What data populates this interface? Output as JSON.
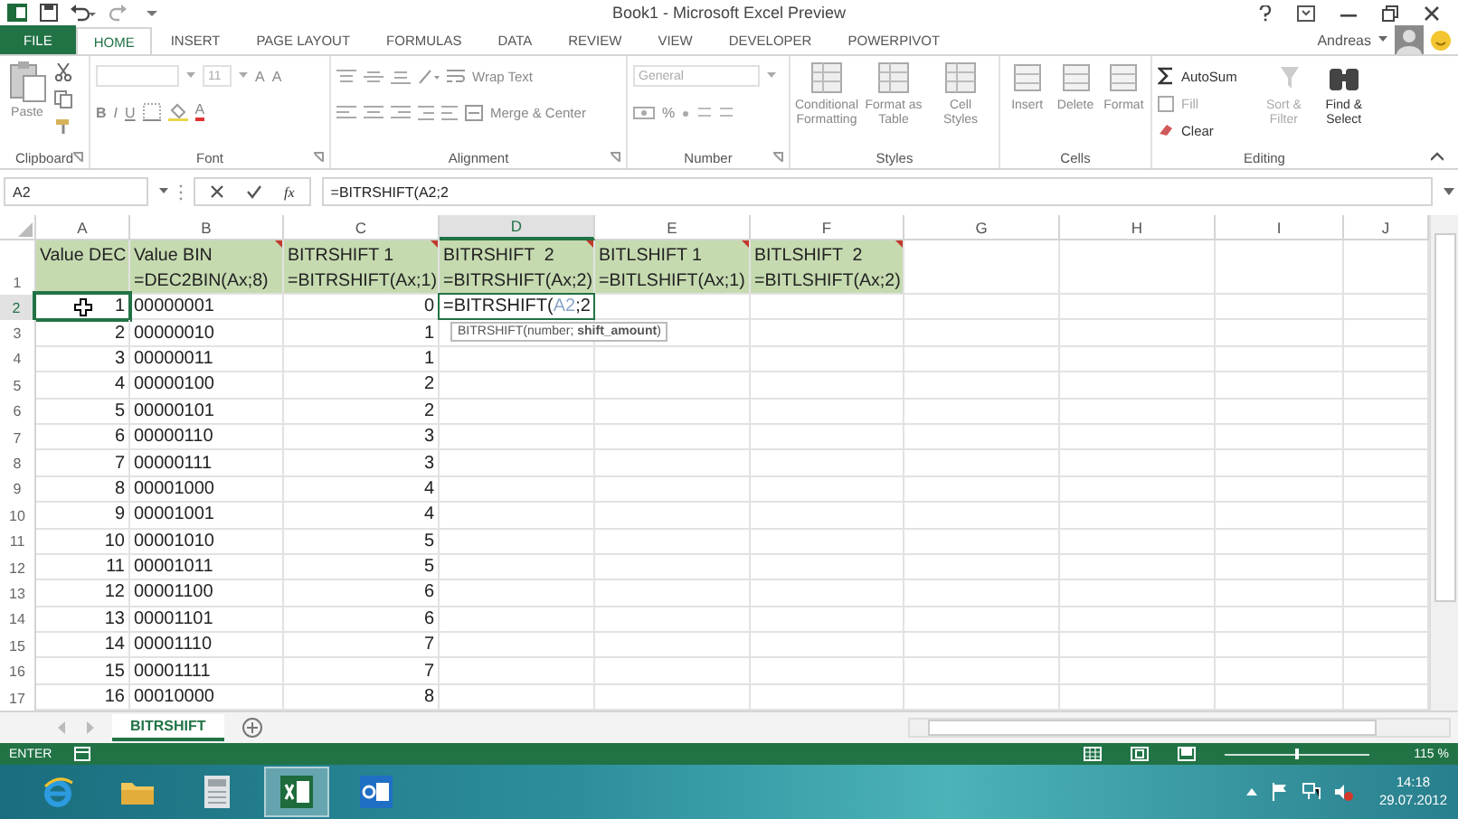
{
  "window": {
    "title": "Book1 - Microsoft Excel Preview"
  },
  "ribbon_tabs": [
    {
      "label": "FILE",
      "kind": "file",
      "selected": false
    },
    {
      "label": "HOME",
      "kind": "tab",
      "selected": true
    },
    {
      "label": "INSERT",
      "kind": "tab",
      "selected": false
    },
    {
      "label": "PAGE LAYOUT",
      "kind": "tab",
      "selected": false
    },
    {
      "label": "FORMULAS",
      "kind": "tab",
      "selected": false
    },
    {
      "label": "DATA",
      "kind": "tab",
      "selected": false
    },
    {
      "label": "REVIEW",
      "kind": "tab",
      "selected": false
    },
    {
      "label": "VIEW",
      "kind": "tab",
      "selected": false
    },
    {
      "label": "DEVELOPER",
      "kind": "tab",
      "selected": false
    },
    {
      "label": "POWERPIVOT",
      "kind": "tab",
      "selected": false
    }
  ],
  "account": {
    "name": "Andreas"
  },
  "ribbon_groups": [
    {
      "kind": "clipboard",
      "label": "Clipboard",
      "paste": "Paste"
    },
    {
      "kind": "font",
      "label": "Font",
      "size": "11",
      "size_buttons": [
        "A",
        "A"
      ],
      "styles": [
        "B",
        "I",
        "U"
      ],
      "color_letter": "A"
    },
    {
      "kind": "alignment",
      "label": "Alignment",
      "wrap": "Wrap Text",
      "merge": "Merge & Center"
    },
    {
      "kind": "number",
      "label": "Number",
      "format": "General",
      "percent": "%"
    },
    {
      "kind": "styles",
      "label": "Styles",
      "buttons": [
        [
          "Conditional",
          "Formatting"
        ],
        [
          "Format as",
          "Table"
        ],
        [
          "Cell",
          "Styles"
        ]
      ]
    },
    {
      "kind": "cells",
      "label": "Cells",
      "buttons": [
        "Insert",
        "Delete",
        "Format"
      ]
    },
    {
      "kind": "editing",
      "label": "Editing",
      "autosum": "AutoSum",
      "fill": "Fill",
      "clear": "Clear",
      "sort": [
        "Sort &",
        "Filter"
      ],
      "find": [
        "Find &",
        "Select"
      ]
    }
  ],
  "formula_bar": {
    "name_box": "A2",
    "function_label": "fx",
    "formula": "=BITRSHIFT(A2;2"
  },
  "sheet": {
    "columns": [
      {
        "label": "A",
        "selected": false
      },
      {
        "label": "B",
        "selected": false
      },
      {
        "label": "C",
        "selected": false
      },
      {
        "label": "D",
        "selected": true
      },
      {
        "label": "E",
        "selected": false
      },
      {
        "label": "F",
        "selected": false
      },
      {
        "label": "G",
        "selected": false
      },
      {
        "label": "H",
        "selected": false
      },
      {
        "label": "I",
        "selected": false
      },
      {
        "label": "J",
        "selected": false
      }
    ],
    "header_row": {
      "number": "1",
      "cells": [
        {
          "lines": [
            "Value DEC"
          ],
          "comment": false
        },
        {
          "lines": [
            "Value BIN",
            "=DEC2BIN(Ax;8)"
          ],
          "comment": true
        },
        {
          "lines": [
            "BITRSHIFT 1",
            "=BITRSHIFT(Ax;1)"
          ],
          "comment": true
        },
        {
          "lines": [
            "BITRSHIFT  2",
            "=BITRSHIFT(Ax;2)"
          ],
          "comment": true
        },
        {
          "lines": [
            "BITLSHIFT 1",
            "=BITLSHIFT(Ax;1)"
          ],
          "comment": true
        },
        {
          "lines": [
            "BITLSHIFT  2",
            "=BITLSHIFT(Ax;2)"
          ],
          "comment": true
        }
      ]
    },
    "rows": [
      {
        "number": "2",
        "selected": true,
        "cells": [
          "1",
          "00000001",
          "0"
        ],
        "editor": {
          "before": "=BITRSHIFT(",
          "ref": "A2",
          "after": ";2",
          "tooltip": "BITRSHIFT(number; **shift_amount**)"
        }
      },
      {
        "number": "3",
        "selected": false,
        "cells": [
          "2",
          "00000010",
          "1"
        ]
      },
      {
        "number": "4",
        "selected": false,
        "cells": [
          "3",
          "00000011",
          "1"
        ]
      },
      {
        "number": "5",
        "selected": false,
        "cells": [
          "4",
          "00000100",
          "2"
        ]
      },
      {
        "number": "6",
        "selected": false,
        "cells": [
          "5",
          "00000101",
          "2"
        ]
      },
      {
        "number": "7",
        "selected": false,
        "cells": [
          "6",
          "00000110",
          "3"
        ]
      },
      {
        "number": "8",
        "selected": false,
        "cells": [
          "7",
          "00000111",
          "3"
        ]
      },
      {
        "number": "9",
        "selected": false,
        "cells": [
          "8",
          "00001000",
          "4"
        ]
      },
      {
        "number": "10",
        "selected": false,
        "cells": [
          "9",
          "00001001",
          "4"
        ]
      },
      {
        "number": "11",
        "selected": false,
        "cells": [
          "10",
          "00001010",
          "5"
        ]
      },
      {
        "number": "12",
        "selected": false,
        "cells": [
          "11",
          "00001011",
          "5"
        ]
      },
      {
        "number": "13",
        "selected": false,
        "cells": [
          "12",
          "00001100",
          "6"
        ]
      },
      {
        "number": "14",
        "selected": false,
        "cells": [
          "13",
          "00001101",
          "6"
        ]
      },
      {
        "number": "15",
        "selected": false,
        "cells": [
          "14",
          "00001110",
          "7"
        ]
      },
      {
        "number": "16",
        "selected": false,
        "cells": [
          "15",
          "00001111",
          "7"
        ]
      },
      {
        "number": "17",
        "selected": false,
        "cells": [
          "16",
          "00010000",
          "8"
        ]
      }
    ]
  },
  "sheet_tabs": [
    {
      "label": "BITRSHIFT",
      "selected": true
    }
  ],
  "status_bar": {
    "mode": "ENTER",
    "zoom": "115 %",
    "zoom_slider": {
      "level": 0.5
    }
  },
  "taskbar": {
    "apps": [
      {
        "kind": "ie",
        "active": false
      },
      {
        "kind": "explorer",
        "active": false
      },
      {
        "kind": "calculator",
        "active": false
      },
      {
        "kind": "excel",
        "active": true
      },
      {
        "kind": "outlook",
        "active": false
      }
    ],
    "time": "14:18",
    "date": "29.07.2012"
  }
}
